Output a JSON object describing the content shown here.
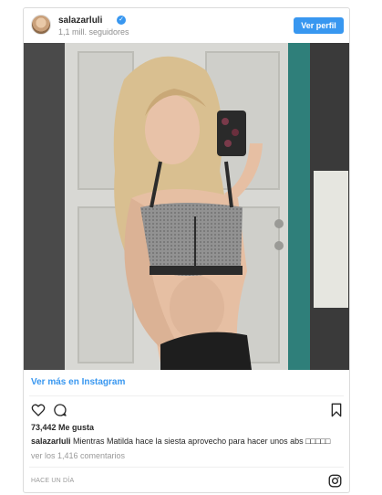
{
  "header": {
    "username": "salazarluli",
    "verified_badge": "✓",
    "followers": "1,1 mill. seguidores",
    "view_profile_label": "Ver perfil"
  },
  "post": {
    "photo_icon": "mirror-selfie-photo"
  },
  "more_link": "Ver más en Instagram",
  "actions": {
    "like_icon": "heart-icon",
    "comment_icon": "comment-icon",
    "save_icon": "bookmark-icon"
  },
  "likes": "73,442 Me gusta",
  "caption": {
    "user": "salazarluli",
    "text": " Mientras Matilda hace la siesta aprovecho para hacer unos abs □□□□□"
  },
  "comments_link": "ver los 1,416 comentarios",
  "timestamp": "HACE UN DÍA",
  "colors": {
    "accent": "#3897f0",
    "text": "#262626",
    "muted": "#999999"
  }
}
